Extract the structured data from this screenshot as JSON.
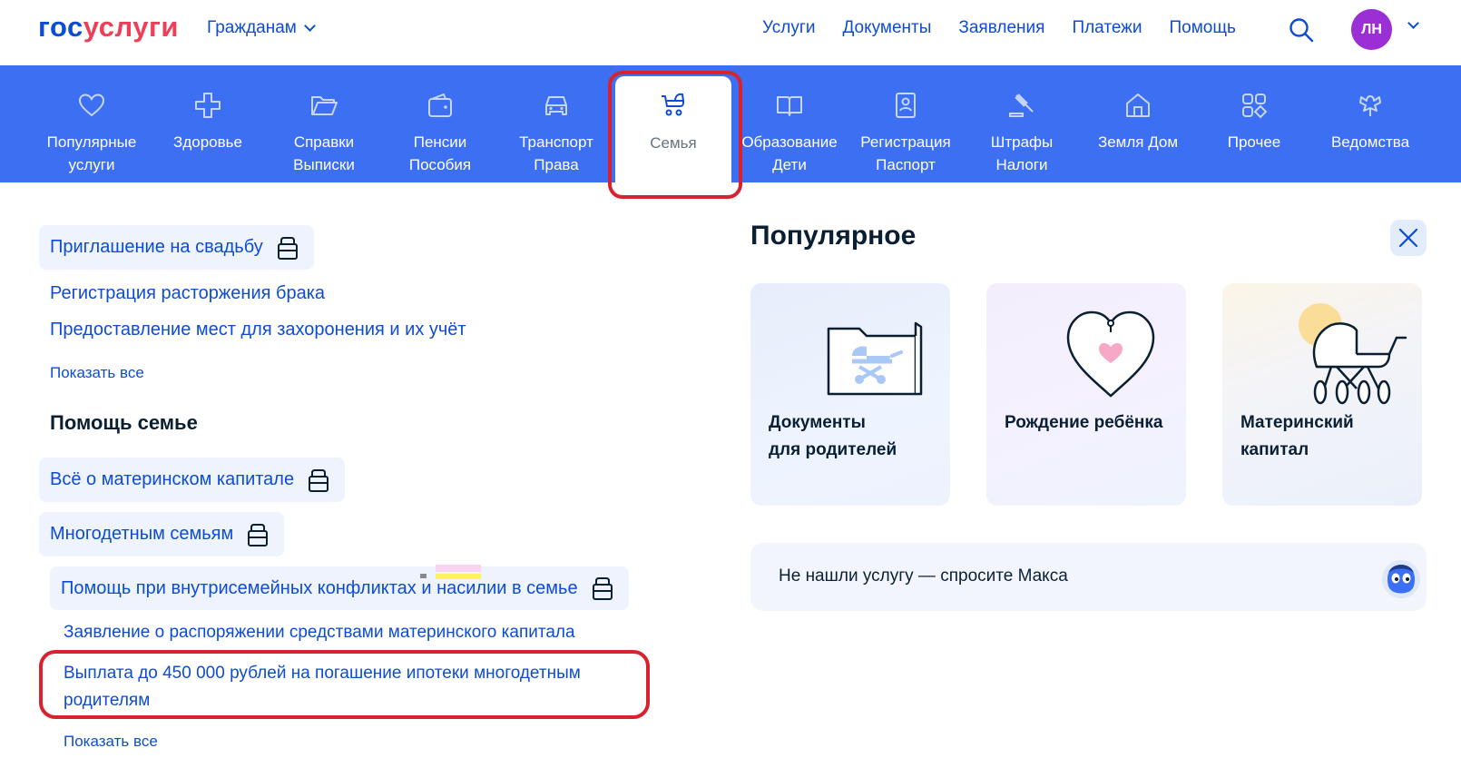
{
  "header": {
    "logo_part1": "гос",
    "logo_part2": "услуги",
    "audience": "Гражданам",
    "nav": [
      "Услуги",
      "Документы",
      "Заявления",
      "Платежи",
      "Помощь"
    ],
    "avatar_initials": "ЛН",
    "accent": "#0d4cd3",
    "avatar_color": "#9b2fd6"
  },
  "categories": [
    {
      "line1": "Популярные",
      "line2": "услуги",
      "icon": "heart-icon"
    },
    {
      "line1": "Здоровье",
      "line2": "",
      "icon": "health-cross-icon"
    },
    {
      "line1": "Справки",
      "line2": "Выписки",
      "icon": "folder-icon"
    },
    {
      "line1": "Пенсии",
      "line2": "Пособия",
      "icon": "wallet-icon"
    },
    {
      "line1": "Транспорт",
      "line2": "Права",
      "icon": "car-icon"
    },
    {
      "line1": "Семья",
      "line2": "",
      "icon": "stroller-icon",
      "active": true
    },
    {
      "line1": "Образование",
      "line2": "Дети",
      "icon": "book-icon"
    },
    {
      "line1": "Регистрация",
      "line2": "Паспорт",
      "icon": "id-card-icon"
    },
    {
      "line1": "Штрафы",
      "line2": "Налоги",
      "icon": "gavel-icon"
    },
    {
      "line1": "Земля Дом",
      "line2": "",
      "icon": "house-icon"
    },
    {
      "line1": "Прочее",
      "line2": "",
      "icon": "grid-icon"
    },
    {
      "line1": "Ведомства",
      "line2": "",
      "icon": "emblem-icon"
    }
  ],
  "category_bar_color": "#3c6ff2",
  "left": {
    "links_top": [
      {
        "label": "Приглашение на свадьбу",
        "bag": true
      },
      {
        "label": "Регистрация расторжения брака",
        "bag": false
      },
      {
        "label": "Предоставление мест для захоронения и их учёт",
        "bag": false
      }
    ],
    "show_all_1": "Показать все",
    "section_title": "Помощь семье",
    "links_help": [
      {
        "label": "Всё о материнском капитале",
        "bag": true
      },
      {
        "label": "Многодетным семьям",
        "bag": true
      },
      {
        "label": "Помощь при внутрисемейных конфликтах и насилии в семье",
        "bag": true
      }
    ],
    "sub_links": [
      "Заявление о распоряжении средствами материнского капитала",
      "Выплата до 450 000 рублей на погашение ипотеки многодетным",
      "родителям"
    ],
    "show_all_2": "Показать все"
  },
  "popular": {
    "title": "Популярное",
    "cards": [
      {
        "line1": "Документы",
        "line2": "для родителей",
        "icon": "folder-stroller-icon"
      },
      {
        "line1": "Рождение ребёнка",
        "line2": "",
        "icon": "heart-ornament-icon"
      },
      {
        "line1": "Материнский",
        "line2": "капитал",
        "icon": "pram-sun-icon"
      }
    ]
  },
  "ask": {
    "text": "Не нашли услугу — спросите Макса"
  },
  "highlight_color": "#d9222e"
}
